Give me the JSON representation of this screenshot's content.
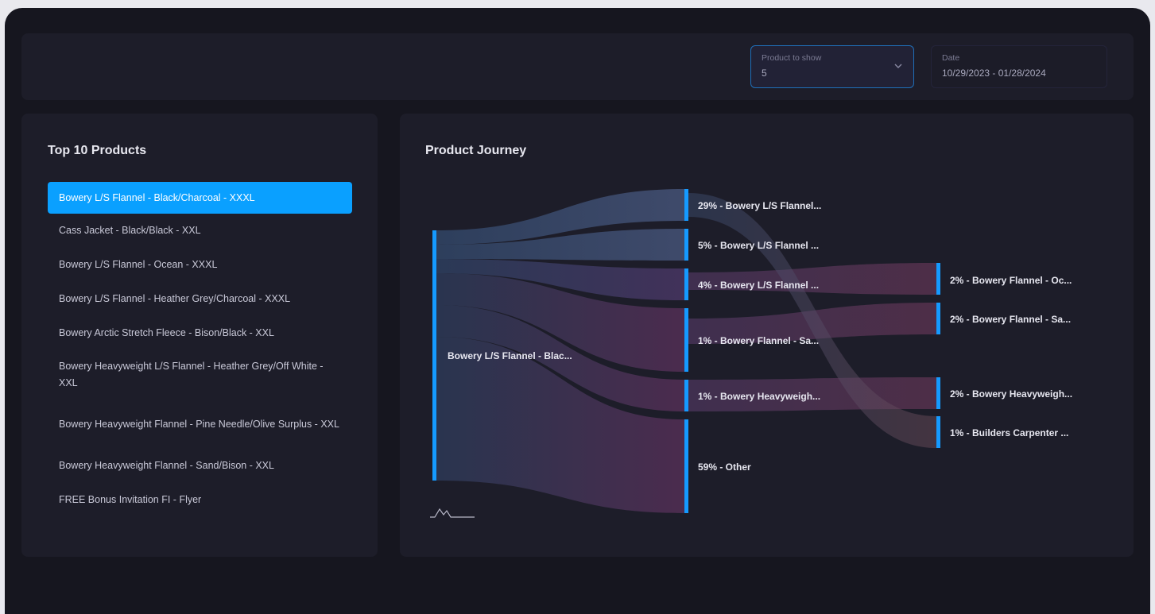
{
  "filters": {
    "product_to_show": {
      "label": "Product to show",
      "value": "5"
    },
    "date": {
      "label": "Date",
      "value": "10/29/2023 - 01/28/2024"
    }
  },
  "top_products": {
    "title": "Top 10 Products",
    "items": [
      {
        "label": "Bowery L/S Flannel - Black/Charcoal - XXXL",
        "active": true
      },
      {
        "label": "Cass Jacket - Black/Black - XXL",
        "active": false
      },
      {
        "label": "Bowery L/S Flannel - Ocean - XXXL",
        "active": false
      },
      {
        "label": "Bowery L/S Flannel - Heather Grey/Charcoal - XXXL",
        "active": false
      },
      {
        "label": "Bowery Arctic Stretch Fleece - Bison/Black - XXL",
        "active": false
      },
      {
        "label": "Bowery Heavyweight L/S Flannel - Heather Grey/Off White - XXL",
        "active": false
      },
      {
        "label": "Bowery Heavyweight Flannel - Pine Needle/Olive Surplus - XXL",
        "active": false
      },
      {
        "label": "Bowery Heavyweight Flannel - Sand/Bison - XXL",
        "active": false
      },
      {
        "label": "FREE Bonus Invitation FI - Flyer",
        "active": false
      }
    ]
  },
  "journey": {
    "title": "Product Journey",
    "source": {
      "label": "Bowery L/S Flannel - Blac..."
    },
    "stage1": [
      {
        "label": "29% - Bowery L/S Flannel...",
        "percent": 29
      },
      {
        "label": "5% - Bowery L/S Flannel ...",
        "percent": 5
      },
      {
        "label": "4% - Bowery L/S Flannel ...",
        "percent": 4
      },
      {
        "label": "1% - Bowery Flannel - Sa...",
        "percent": 1
      },
      {
        "label": "1% - Bowery Heavyweigh...",
        "percent": 1
      },
      {
        "label": "59% - Other",
        "percent": 59
      }
    ],
    "stage2": [
      {
        "label": "2% - Bowery Flannel - Oc...",
        "percent": 2
      },
      {
        "label": "2% - Bowery Flannel - Sa...",
        "percent": 2
      },
      {
        "label": "2% - Bowery Heavyweigh...",
        "percent": 2
      },
      {
        "label": "1% - Builders Carpenter ...",
        "percent": 1
      }
    ]
  },
  "colors": {
    "accent": "#0aa0ff",
    "node_bar": "#159aff",
    "panel_bg": "#1d1d29",
    "page_bg": "#16161f"
  },
  "icons": {
    "dropdown": "chevron-down-icon",
    "brand": "mountain-logo-icon"
  }
}
